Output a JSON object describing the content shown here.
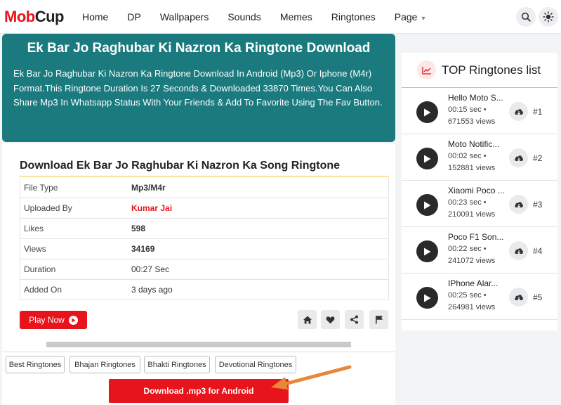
{
  "header": {
    "logo_part1": "Mob",
    "logo_part2": "Cup",
    "nav": [
      "Home",
      "DP",
      "Wallpapers",
      "Sounds",
      "Memes",
      "Ringtones",
      "Page"
    ]
  },
  "hero": {
    "title": "Ek Bar Jo Raghubar Ki Nazron Ka Ringtone Download",
    "description": "Ek Bar Jo Raghubar Ki Nazron Ka Ringtone Download In Android (Mp3) Or Iphone (M4r) Format.This Ringtone Duration Is 27 Seconds & Downloaded 33870 Times.You Can Also Share Mp3 In Whatsapp Status With Your Friends & Add To Favorite Using The Fav Button."
  },
  "details": {
    "heading": "Download Ek Bar Jo Raghubar Ki Nazron Ka Song Ringtone",
    "rows": [
      {
        "label": "File Type",
        "value": "Mp3/M4r"
      },
      {
        "label": "Uploaded By",
        "value": "Kumar Jai"
      },
      {
        "label": "Likes",
        "value": "598"
      },
      {
        "label": "Views",
        "value": "34169"
      },
      {
        "label": "Duration",
        "value": "00:27 Sec"
      },
      {
        "label": "Added On",
        "value": "3 days ago"
      }
    ],
    "play_label": "Play Now"
  },
  "tags": [
    "Best Ringtones",
    "Bhajan Ringtones",
    "Bhakti Ringtones",
    "Devotional Ringtones"
  ],
  "download_label": "Download .mp3 for Android",
  "sidebar": {
    "title": "TOP Ringtones list",
    "items": [
      {
        "name": "Hello Moto S...",
        "duration": "00:15 sec •",
        "views": "671553 views",
        "rank": "#1"
      },
      {
        "name": "Moto Notific...",
        "duration": "00:02 sec •",
        "views": "152881 views",
        "rank": "#2"
      },
      {
        "name": "Xiaomi Poco ...",
        "duration": "00:23 sec •",
        "views": "210091 views",
        "rank": "#3"
      },
      {
        "name": "Poco F1 Son...",
        "duration": "00:22 sec •",
        "views": "241072 views",
        "rank": "#4"
      },
      {
        "name": "IPhone Alar...",
        "duration": "00:25 sec •",
        "views": "264981 views",
        "rank": "#5"
      }
    ]
  },
  "colors": {
    "brand_red": "#e8141b",
    "hero_teal": "#1a7a7d",
    "accent_yellow": "#f1c232"
  },
  "icons": [
    "search-icon",
    "theme-toggle-icon",
    "home-icon",
    "heart-icon",
    "share-icon",
    "flag-icon",
    "play-icon",
    "download-icon",
    "trend-icon"
  ]
}
